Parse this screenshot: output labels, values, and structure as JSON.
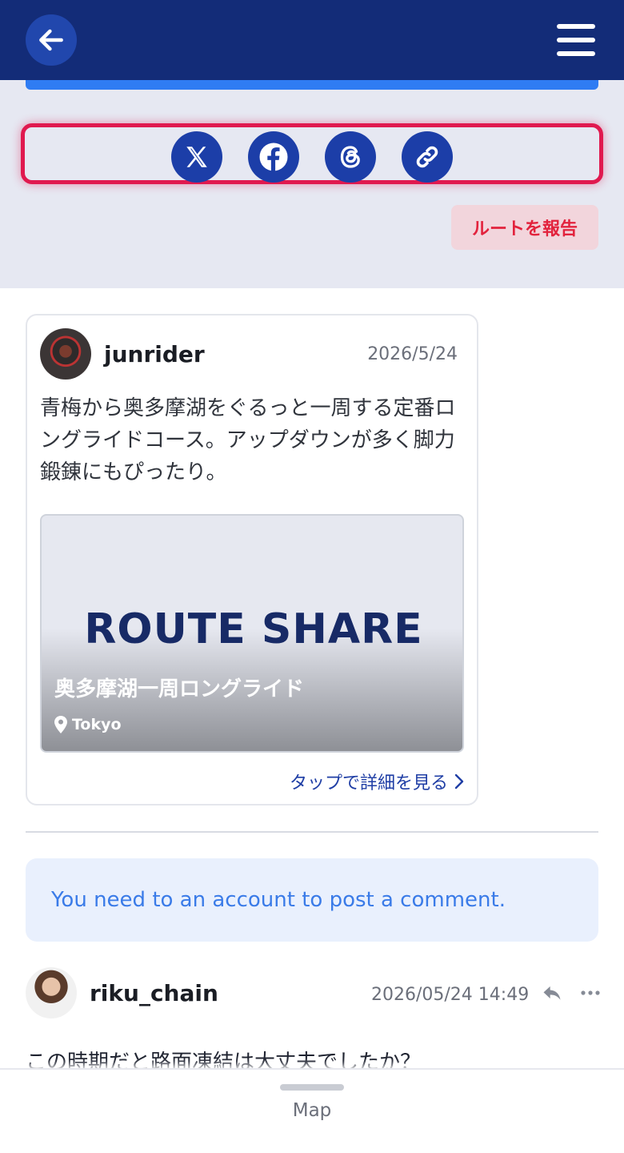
{
  "header": {
    "back_icon": "arrow-left-icon",
    "menu_icon": "hamburger-menu-icon",
    "background": "#132c78"
  },
  "share": {
    "items": [
      {
        "icon": "x-logo-icon",
        "label": "X"
      },
      {
        "icon": "facebook-icon",
        "label": "Facebook"
      },
      {
        "icon": "threads-icon",
        "label": "Threads"
      },
      {
        "icon": "link-icon",
        "label": "Copy link"
      }
    ],
    "highlight_color": "#e0194f"
  },
  "report": {
    "label": "ルートを報告"
  },
  "post": {
    "username": "junrider",
    "date": "2026/5/24",
    "text": "青梅から奥多摩湖をぐるっと一周する定番ロングライドコース。アップダウンが多く脚力鍛錬にもぴったり。",
    "route": {
      "logo_text": "ROUTE SHARE",
      "title": "奥多摩湖一周ロングライド",
      "location": "Tokyo"
    },
    "link_label": "タップで詳細を見る"
  },
  "comments_section": {
    "login_notice": "You need to an account to post a comment.",
    "comments": [
      {
        "username": "riku_chain",
        "date": "2026/05/24 14:49",
        "text": "この時期だと路面凍結は大丈夫でしたか？"
      }
    ]
  },
  "bottom_sheet": {
    "label": "Map"
  }
}
